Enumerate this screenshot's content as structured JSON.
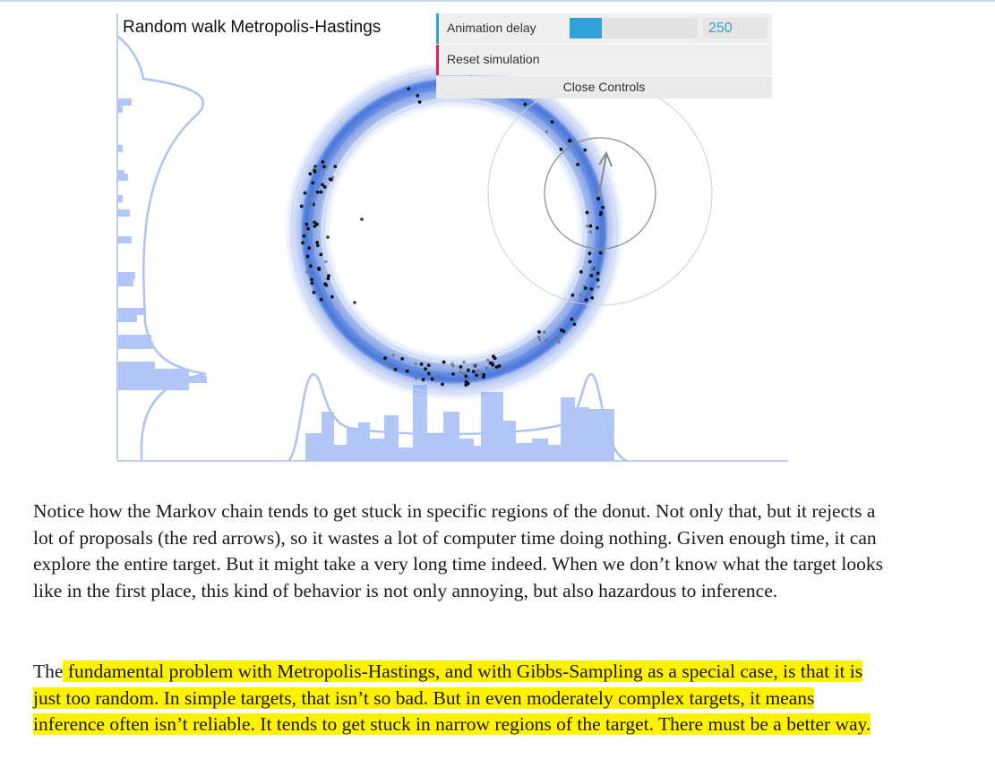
{
  "simulation": {
    "title": "Random walk Metropolis-Hastings"
  },
  "controls": {
    "animation_delay_label": "Animation delay",
    "animation_delay_value": "250",
    "animation_delay_fraction": 0.25,
    "reset_label": "Reset simulation",
    "close_label": "Close Controls"
  },
  "colors": {
    "density": "#3d6fd9",
    "histogram": "#b3c7f7",
    "slider": "#2fa1d6",
    "reset_accent": "#e61d5f",
    "highlight": "#fff200"
  },
  "article": {
    "paragraph1": "Notice how the Markov chain tends to get stuck in specific regions of the donut. Not only that, but it rejects a lot of proposals (the red arrows), so it wastes a lot of computer time doing nothing. Given enough time, it can explore the entire target. But it might take a very long time indeed. When we don’t know what the target looks like in the first place, this kind of behavior is not only annoying, but also hazardous to inference.",
    "paragraph2_lead": "The",
    "paragraph2_highlight": " fundamental problem with Metropolis-Hastings, and with Gibbs-Sampling as a special case, is that it is just too random. In simple targets, that isn’t so bad. But in even moderately complex targets, it means inference often isn’t reliable. It tends to get stuck in narrow regions of the target. There must be a better way."
  }
}
